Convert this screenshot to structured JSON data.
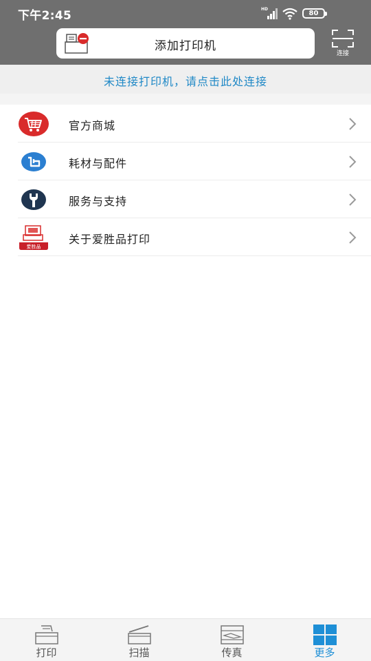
{
  "status_bar": {
    "time": "下午2:45",
    "battery": "80",
    "icons": [
      "hd-signal-icon",
      "wifi-icon",
      "battery-icon"
    ]
  },
  "toolbar": {
    "add_printer_label": "添加打印机",
    "scan_label": "连接"
  },
  "notice": {
    "text": "未连接打印机，请点击此处连接"
  },
  "menu": {
    "items": [
      {
        "label": "官方商城",
        "icon": "shopping-cart-icon"
      },
      {
        "label": "耗材与配件",
        "icon": "consumables-icon"
      },
      {
        "label": "服务与支持",
        "icon": "wrench-icon"
      },
      {
        "label": "关于爱胜品打印",
        "icon": "brand-logo-icon",
        "logo_text": "爱胜品"
      }
    ]
  },
  "tabs": [
    {
      "label": "打印",
      "icon": "printer-icon",
      "active": false
    },
    {
      "label": "扫描",
      "icon": "scanner-icon",
      "active": false
    },
    {
      "label": "传真",
      "icon": "fax-icon",
      "active": false
    },
    {
      "label": "更多",
      "icon": "grid-icon",
      "active": true
    }
  ],
  "colors": {
    "header_bg": "#6f6f6f",
    "notice_text": "#1f88c6",
    "active_tab": "#1e8fd6",
    "brand_red": "#d92b2b",
    "consumables_blue": "#2b7fd1",
    "wrench_navy": "#1f3550"
  }
}
